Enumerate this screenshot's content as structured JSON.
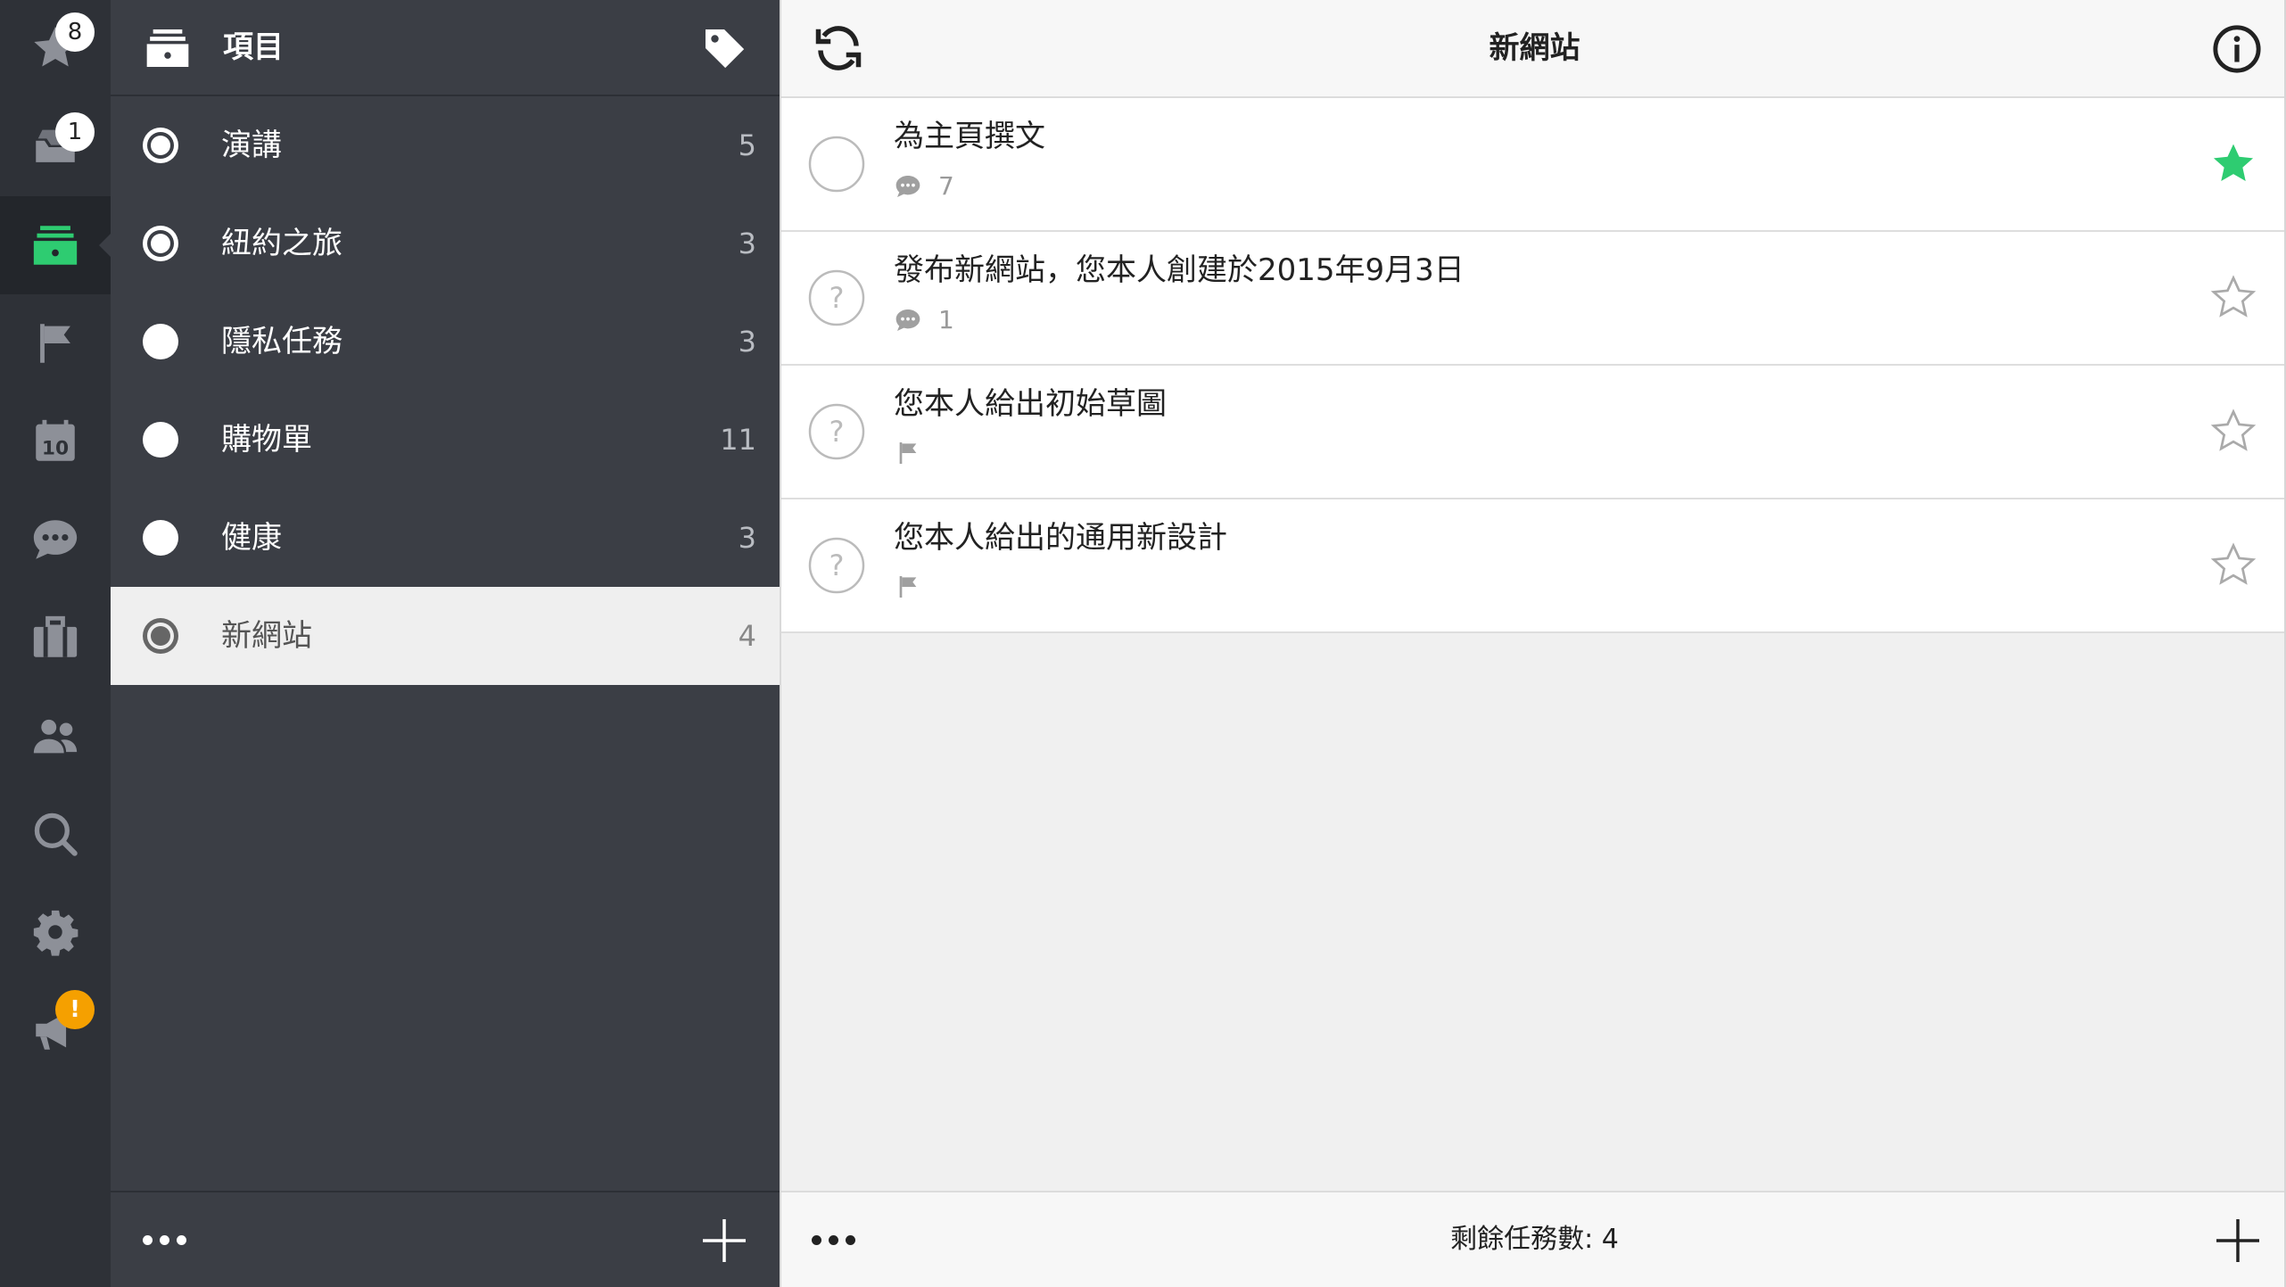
{
  "colors": {
    "rail_bg": "#2e3137",
    "panel_bg": "#3b3e45",
    "accent_green": "#2ecc71",
    "warning_orange": "#f5a000"
  },
  "rail": {
    "items": [
      {
        "name": "starred",
        "icon": "star-icon",
        "badge": "8"
      },
      {
        "name": "inbox",
        "icon": "inbox-icon",
        "badge": "1"
      },
      {
        "name": "projects",
        "icon": "projects-icon",
        "active": true
      },
      {
        "name": "flagged",
        "icon": "flag-icon"
      },
      {
        "name": "calendar",
        "icon": "calendar-icon",
        "label": "10"
      },
      {
        "name": "comments",
        "icon": "chat-icon"
      },
      {
        "name": "business",
        "icon": "briefcase-icon"
      },
      {
        "name": "contacts",
        "icon": "people-icon"
      },
      {
        "name": "search",
        "icon": "search-icon"
      },
      {
        "name": "settings",
        "icon": "gear-icon"
      },
      {
        "name": "announcements",
        "icon": "megaphone-icon",
        "badge": "!"
      }
    ]
  },
  "projects": {
    "title": "項目",
    "list": [
      {
        "name": "演講",
        "count": "5",
        "radio": "ring"
      },
      {
        "name": "紐約之旅",
        "count": "3",
        "radio": "ring"
      },
      {
        "name": "隱私任務",
        "count": "3",
        "radio": "filled"
      },
      {
        "name": "購物單",
        "count": "11",
        "radio": "filled"
      },
      {
        "name": "健康",
        "count": "3",
        "radio": "filled"
      },
      {
        "name": "新網站",
        "count": "4",
        "radio": "ring",
        "selected": true
      }
    ]
  },
  "tasks": {
    "title": "新網站",
    "items": [
      {
        "title": "為主頁撰文",
        "meta_icon": "comment-icon",
        "meta_count": "7",
        "starred": true,
        "status": "open"
      },
      {
        "title": "發布新網站，您本人創建於2015年9月3日",
        "meta_icon": "comment-icon",
        "meta_count": "1",
        "starred": false,
        "status": "unknown"
      },
      {
        "title": "您本人給出初始草圖",
        "meta_icon": "flag-icon",
        "meta_count": "",
        "starred": false,
        "status": "unknown"
      },
      {
        "title": "您本人給出的通用新設計",
        "meta_icon": "flag-icon",
        "meta_count": "",
        "starred": false,
        "status": "unknown"
      }
    ],
    "remaining_label": "剩餘任務數: 4"
  }
}
